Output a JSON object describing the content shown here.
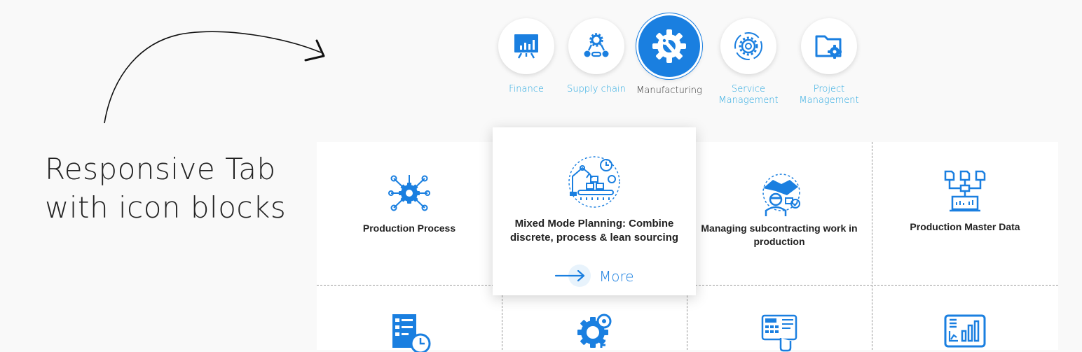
{
  "promo": {
    "line1": "Responsive Tab",
    "line2": "with icon blocks"
  },
  "tabs": [
    {
      "label_lines": [
        "Finance"
      ],
      "icon": "presentation-chart-icon",
      "active": false
    },
    {
      "label_lines": [
        "Supply chain"
      ],
      "icon": "supply-chain-network-icon",
      "active": false
    },
    {
      "label_lines": [
        "Manufacturing"
      ],
      "icon": "gear-wrench-icon",
      "active": true
    },
    {
      "label_lines": [
        "Service",
        "Management"
      ],
      "icon": "gear-cycle-icon",
      "active": false
    },
    {
      "label_lines": [
        "Project",
        "Management"
      ],
      "icon": "folder-gear-icon",
      "active": false
    }
  ],
  "blocks": [
    {
      "title": "Production Process",
      "icon": "gear-network-icon"
    },
    {
      "title": "Mixed Mode Planning: Combine discrete, process & lean sourcing",
      "icon": "robotic-assembly-line-icon",
      "featured": true,
      "more_label": "More"
    },
    {
      "title": "Managing subcontracting work in production",
      "icon": "handshake-worker-icon"
    },
    {
      "title": "Production Master Data",
      "icon": "data-flow-monitor-icon"
    },
    {
      "title": "",
      "icon": "schedule-list-clock-icon"
    },
    {
      "title": "",
      "icon": "gear-key-icon"
    },
    {
      "title": "",
      "icon": "control-panel-icon"
    },
    {
      "title": "",
      "icon": "dashboard-chart-icon"
    }
  ],
  "colors": {
    "accent": "#1a7fe0",
    "tab_label": "#29a8e0",
    "background": "#f9f9f9"
  }
}
